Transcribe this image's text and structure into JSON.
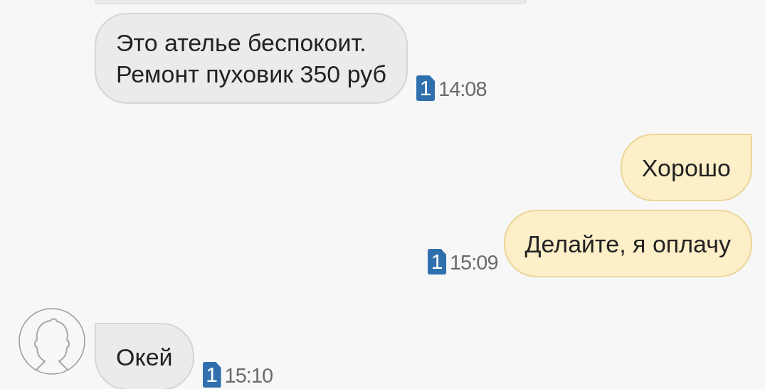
{
  "messages": [
    {
      "kind": "partial"
    },
    {
      "kind": "incoming",
      "tail": false,
      "lines": [
        "Это ателье беспокоит.",
        "Ремонт пуховик 350 руб"
      ],
      "sim": "1",
      "time": "14:08"
    },
    {
      "kind": "outgoing",
      "tail": true,
      "lines": [
        "Хорошо"
      ]
    },
    {
      "kind": "outgoing",
      "tail": false,
      "lines": [
        "Делайте, я оплачу"
      ],
      "sim": "1",
      "time": "15:09"
    },
    {
      "kind": "incoming",
      "tail": true,
      "avatar": true,
      "lines": [
        "Окей"
      ],
      "sim": "1",
      "time": "15:10"
    }
  ]
}
